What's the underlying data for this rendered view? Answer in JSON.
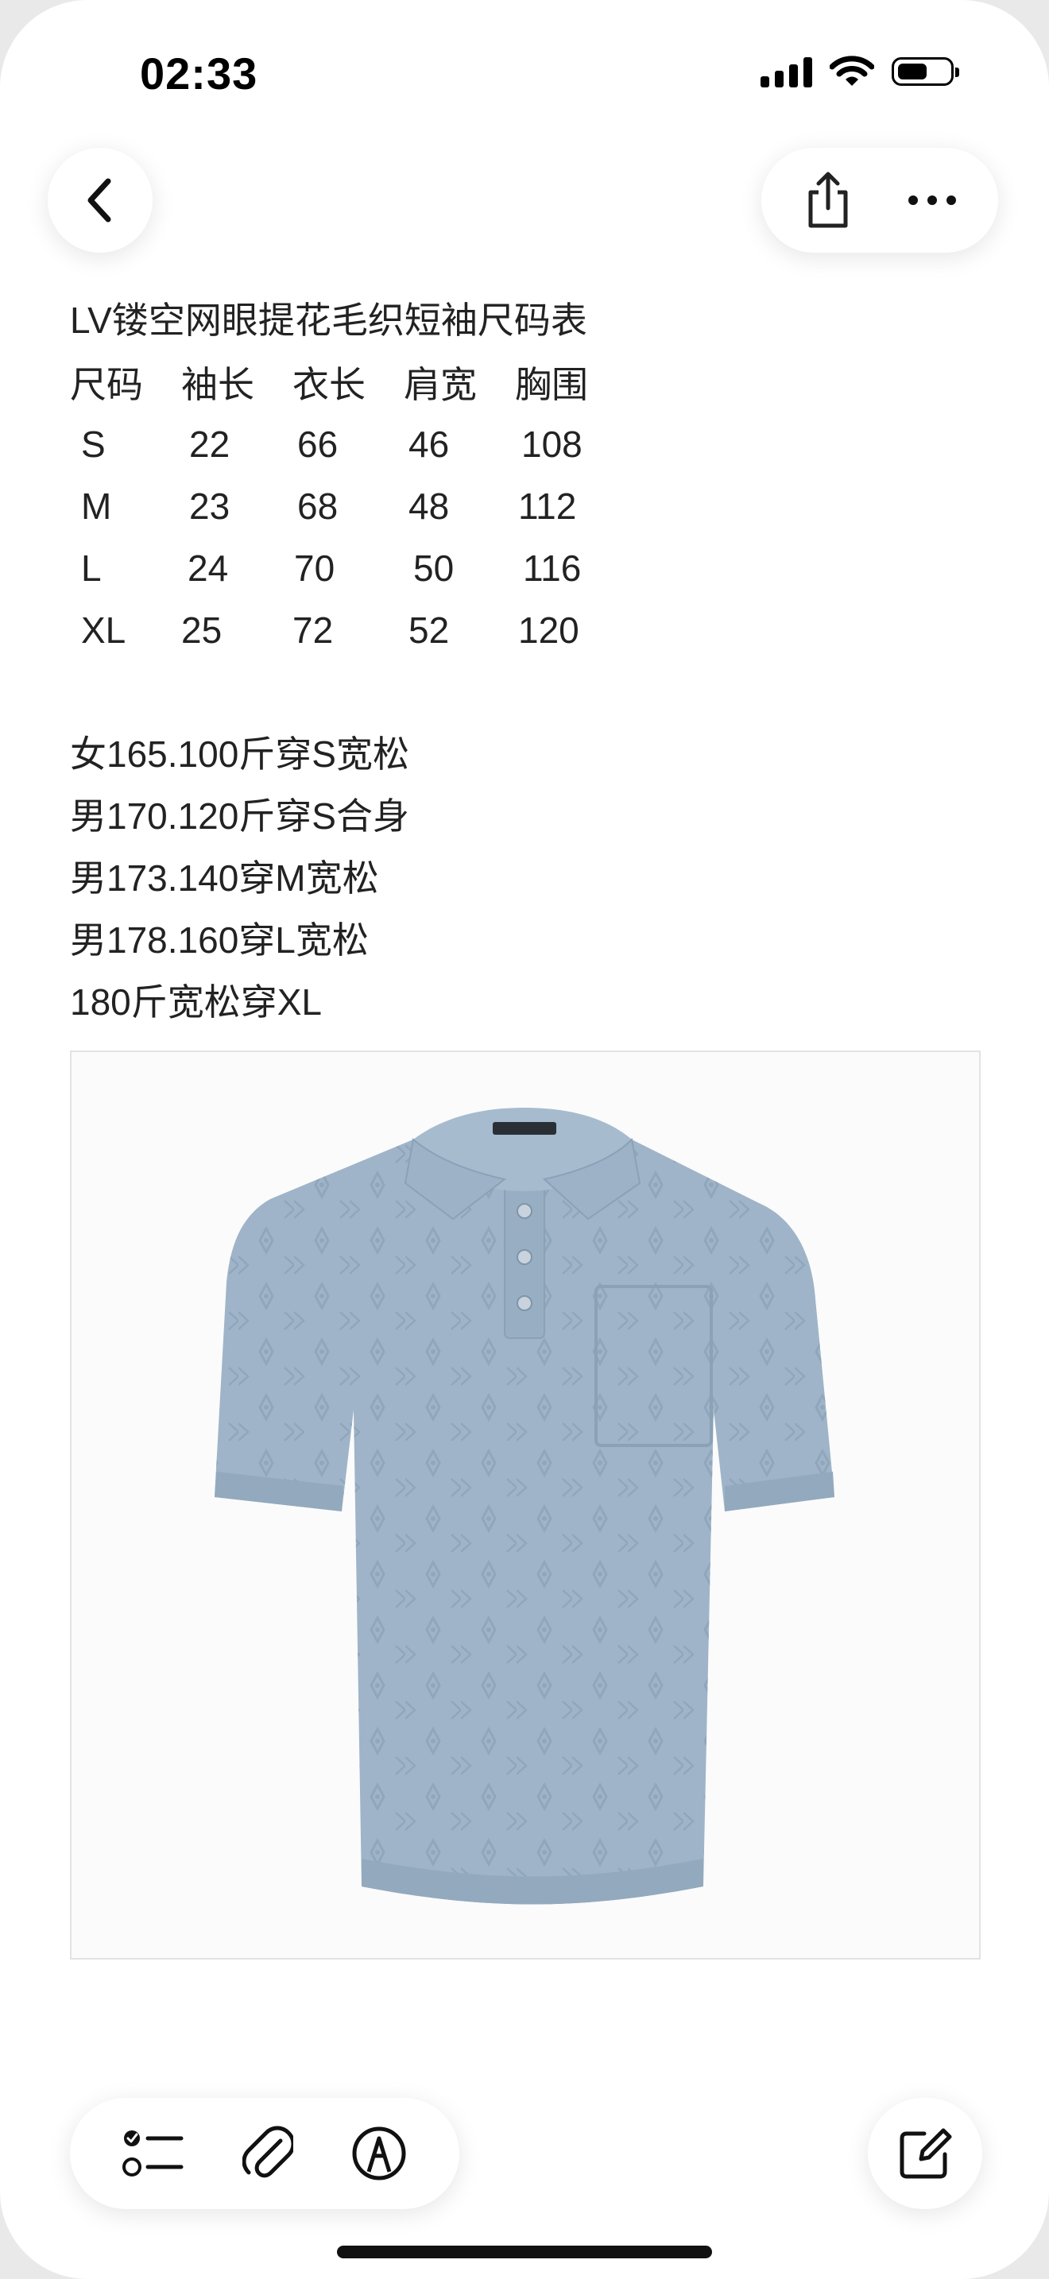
{
  "status_bar": {
    "time": "02:33"
  },
  "note": {
    "title": "LV镂空网眼提花毛织短袖尺码表",
    "table": {
      "headers": [
        "尺码",
        "袖长",
        "衣长",
        "肩宽",
        "胸围"
      ],
      "rows": [
        [
          "S",
          "22",
          "66",
          "46",
          "108"
        ],
        [
          "M",
          "23",
          "68",
          "48",
          "112"
        ],
        [
          "L",
          "24",
          "70",
          "50",
          "116"
        ],
        [
          "XL",
          "25",
          "72",
          "52",
          "120"
        ]
      ]
    },
    "recommendations": [
      "女165.100斤穿S宽松",
      "男170.120斤穿S合身",
      "男173.140穿M宽松",
      "男178.160穿L宽松",
      "180斤宽松穿XL"
    ]
  },
  "image": {
    "subject": "light blue knit polo shirt",
    "color": "#9fb4c8"
  },
  "toolbar": {
    "top": [
      "back-icon",
      "share-icon",
      "more-icon"
    ],
    "bottom": [
      "checklist-icon",
      "attachment-icon",
      "markup-icon",
      "compose-icon"
    ]
  }
}
